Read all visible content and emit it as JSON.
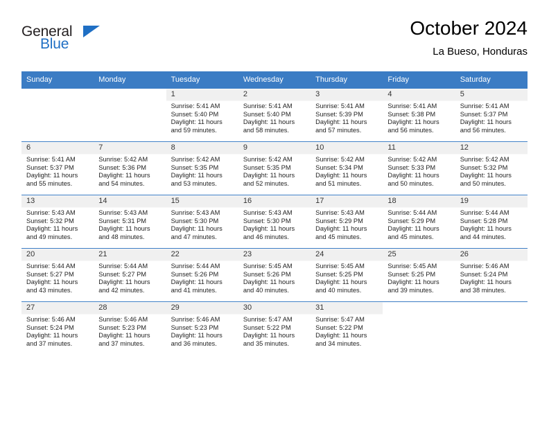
{
  "brand": {
    "name_top": "General",
    "name_bottom": "Blue",
    "accent_color": "#1f6fc4"
  },
  "header": {
    "title": "October 2024",
    "subtitle": "La Bueso, Honduras"
  },
  "theme": {
    "header_bg": "#3b7cc4",
    "header_text": "#ffffff",
    "daynum_band": "#f0f0f0",
    "grid_line": "#3b7cc4"
  },
  "weekdays": [
    "Sunday",
    "Monday",
    "Tuesday",
    "Wednesday",
    "Thursday",
    "Friday",
    "Saturday"
  ],
  "labels": {
    "sunrise_prefix": "Sunrise:",
    "sunset_prefix": "Sunset:",
    "daylight_prefix": "Daylight:"
  },
  "weeks": [
    [
      {
        "day": "",
        "sunrise": "",
        "sunset": "",
        "daylight_line1": "",
        "daylight_line2": ""
      },
      {
        "day": "",
        "sunrise": "",
        "sunset": "",
        "daylight_line1": "",
        "daylight_line2": ""
      },
      {
        "day": "1",
        "sunrise": "Sunrise: 5:41 AM",
        "sunset": "Sunset: 5:40 PM",
        "daylight_line1": "Daylight: 11 hours",
        "daylight_line2": "and 59 minutes."
      },
      {
        "day": "2",
        "sunrise": "Sunrise: 5:41 AM",
        "sunset": "Sunset: 5:40 PM",
        "daylight_line1": "Daylight: 11 hours",
        "daylight_line2": "and 58 minutes."
      },
      {
        "day": "3",
        "sunrise": "Sunrise: 5:41 AM",
        "sunset": "Sunset: 5:39 PM",
        "daylight_line1": "Daylight: 11 hours",
        "daylight_line2": "and 57 minutes."
      },
      {
        "day": "4",
        "sunrise": "Sunrise: 5:41 AM",
        "sunset": "Sunset: 5:38 PM",
        "daylight_line1": "Daylight: 11 hours",
        "daylight_line2": "and 56 minutes."
      },
      {
        "day": "5",
        "sunrise": "Sunrise: 5:41 AM",
        "sunset": "Sunset: 5:37 PM",
        "daylight_line1": "Daylight: 11 hours",
        "daylight_line2": "and 56 minutes."
      }
    ],
    [
      {
        "day": "6",
        "sunrise": "Sunrise: 5:41 AM",
        "sunset": "Sunset: 5:37 PM",
        "daylight_line1": "Daylight: 11 hours",
        "daylight_line2": "and 55 minutes."
      },
      {
        "day": "7",
        "sunrise": "Sunrise: 5:42 AM",
        "sunset": "Sunset: 5:36 PM",
        "daylight_line1": "Daylight: 11 hours",
        "daylight_line2": "and 54 minutes."
      },
      {
        "day": "8",
        "sunrise": "Sunrise: 5:42 AM",
        "sunset": "Sunset: 5:35 PM",
        "daylight_line1": "Daylight: 11 hours",
        "daylight_line2": "and 53 minutes."
      },
      {
        "day": "9",
        "sunrise": "Sunrise: 5:42 AM",
        "sunset": "Sunset: 5:35 PM",
        "daylight_line1": "Daylight: 11 hours",
        "daylight_line2": "and 52 minutes."
      },
      {
        "day": "10",
        "sunrise": "Sunrise: 5:42 AM",
        "sunset": "Sunset: 5:34 PM",
        "daylight_line1": "Daylight: 11 hours",
        "daylight_line2": "and 51 minutes."
      },
      {
        "day": "11",
        "sunrise": "Sunrise: 5:42 AM",
        "sunset": "Sunset: 5:33 PM",
        "daylight_line1": "Daylight: 11 hours",
        "daylight_line2": "and 50 minutes."
      },
      {
        "day": "12",
        "sunrise": "Sunrise: 5:42 AM",
        "sunset": "Sunset: 5:32 PM",
        "daylight_line1": "Daylight: 11 hours",
        "daylight_line2": "and 50 minutes."
      }
    ],
    [
      {
        "day": "13",
        "sunrise": "Sunrise: 5:43 AM",
        "sunset": "Sunset: 5:32 PM",
        "daylight_line1": "Daylight: 11 hours",
        "daylight_line2": "and 49 minutes."
      },
      {
        "day": "14",
        "sunrise": "Sunrise: 5:43 AM",
        "sunset": "Sunset: 5:31 PM",
        "daylight_line1": "Daylight: 11 hours",
        "daylight_line2": "and 48 minutes."
      },
      {
        "day": "15",
        "sunrise": "Sunrise: 5:43 AM",
        "sunset": "Sunset: 5:30 PM",
        "daylight_line1": "Daylight: 11 hours",
        "daylight_line2": "and 47 minutes."
      },
      {
        "day": "16",
        "sunrise": "Sunrise: 5:43 AM",
        "sunset": "Sunset: 5:30 PM",
        "daylight_line1": "Daylight: 11 hours",
        "daylight_line2": "and 46 minutes."
      },
      {
        "day": "17",
        "sunrise": "Sunrise: 5:43 AM",
        "sunset": "Sunset: 5:29 PM",
        "daylight_line1": "Daylight: 11 hours",
        "daylight_line2": "and 45 minutes."
      },
      {
        "day": "18",
        "sunrise": "Sunrise: 5:44 AM",
        "sunset": "Sunset: 5:29 PM",
        "daylight_line1": "Daylight: 11 hours",
        "daylight_line2": "and 45 minutes."
      },
      {
        "day": "19",
        "sunrise": "Sunrise: 5:44 AM",
        "sunset": "Sunset: 5:28 PM",
        "daylight_line1": "Daylight: 11 hours",
        "daylight_line2": "and 44 minutes."
      }
    ],
    [
      {
        "day": "20",
        "sunrise": "Sunrise: 5:44 AM",
        "sunset": "Sunset: 5:27 PM",
        "daylight_line1": "Daylight: 11 hours",
        "daylight_line2": "and 43 minutes."
      },
      {
        "day": "21",
        "sunrise": "Sunrise: 5:44 AM",
        "sunset": "Sunset: 5:27 PM",
        "daylight_line1": "Daylight: 11 hours",
        "daylight_line2": "and 42 minutes."
      },
      {
        "day": "22",
        "sunrise": "Sunrise: 5:44 AM",
        "sunset": "Sunset: 5:26 PM",
        "daylight_line1": "Daylight: 11 hours",
        "daylight_line2": "and 41 minutes."
      },
      {
        "day": "23",
        "sunrise": "Sunrise: 5:45 AM",
        "sunset": "Sunset: 5:26 PM",
        "daylight_line1": "Daylight: 11 hours",
        "daylight_line2": "and 40 minutes."
      },
      {
        "day": "24",
        "sunrise": "Sunrise: 5:45 AM",
        "sunset": "Sunset: 5:25 PM",
        "daylight_line1": "Daylight: 11 hours",
        "daylight_line2": "and 40 minutes."
      },
      {
        "day": "25",
        "sunrise": "Sunrise: 5:45 AM",
        "sunset": "Sunset: 5:25 PM",
        "daylight_line1": "Daylight: 11 hours",
        "daylight_line2": "and 39 minutes."
      },
      {
        "day": "26",
        "sunrise": "Sunrise: 5:46 AM",
        "sunset": "Sunset: 5:24 PM",
        "daylight_line1": "Daylight: 11 hours",
        "daylight_line2": "and 38 minutes."
      }
    ],
    [
      {
        "day": "27",
        "sunrise": "Sunrise: 5:46 AM",
        "sunset": "Sunset: 5:24 PM",
        "daylight_line1": "Daylight: 11 hours",
        "daylight_line2": "and 37 minutes."
      },
      {
        "day": "28",
        "sunrise": "Sunrise: 5:46 AM",
        "sunset": "Sunset: 5:23 PM",
        "daylight_line1": "Daylight: 11 hours",
        "daylight_line2": "and 37 minutes."
      },
      {
        "day": "29",
        "sunrise": "Sunrise: 5:46 AM",
        "sunset": "Sunset: 5:23 PM",
        "daylight_line1": "Daylight: 11 hours",
        "daylight_line2": "and 36 minutes."
      },
      {
        "day": "30",
        "sunrise": "Sunrise: 5:47 AM",
        "sunset": "Sunset: 5:22 PM",
        "daylight_line1": "Daylight: 11 hours",
        "daylight_line2": "and 35 minutes."
      },
      {
        "day": "31",
        "sunrise": "Sunrise: 5:47 AM",
        "sunset": "Sunset: 5:22 PM",
        "daylight_line1": "Daylight: 11 hours",
        "daylight_line2": "and 34 minutes."
      },
      {
        "day": "",
        "sunrise": "",
        "sunset": "",
        "daylight_line1": "",
        "daylight_line2": ""
      },
      {
        "day": "",
        "sunrise": "",
        "sunset": "",
        "daylight_line1": "",
        "daylight_line2": ""
      }
    ]
  ]
}
